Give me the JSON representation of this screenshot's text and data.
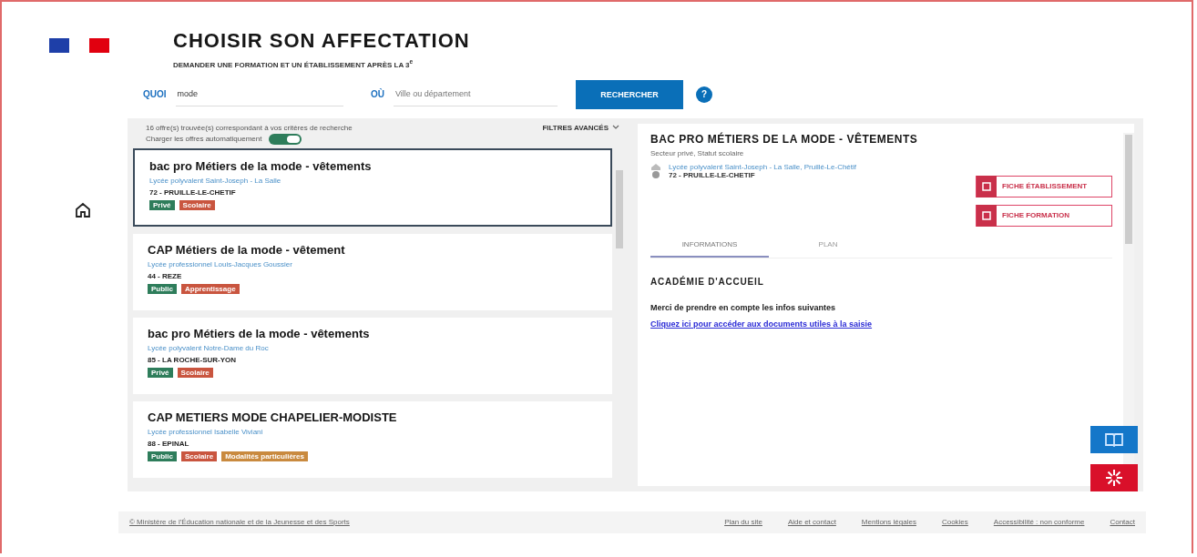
{
  "header": {
    "title": "CHOISIR SON AFFECTATION",
    "subtitle": "DEMANDER UNE FORMATION ET UN ÉTABLISSEMENT APRÈS LA 3$^{e}$"
  },
  "search": {
    "what_label": "QUOI",
    "what_value": "mode",
    "where_label": "OÙ",
    "where_placeholder": "Ville ou département",
    "button": "RECHERCHER",
    "help": "?"
  },
  "results": {
    "count_text": "16 offre(s) trouvée(s) correspondant à vos critères de recherche",
    "auto_load_label": "Charger les offres automatiquement",
    "auto_load_on": true,
    "filters": "FILTRES AVANCÉS"
  },
  "offers": [
    {
      "title": "bac pro Métiers de la mode - vêtements",
      "school": "Lycée polyvalent Saint-Joseph - La Salle",
      "place": "72 - PRUILLE-LE-CHETIF",
      "selected": true,
      "tags": [
        {
          "label": "Privé",
          "color": "#2e7d5b"
        },
        {
          "label": "Scolaire",
          "color": "#c9553f"
        }
      ]
    },
    {
      "title": "CAP Métiers de la mode - vêtement",
      "school": "Lycée professionnel Louis-Jacques Goussier",
      "place": "44 - REZE",
      "selected": false,
      "tags": [
        {
          "label": "Public",
          "color": "#2e7d5b"
        },
        {
          "label": "Apprentissage",
          "color": "#c9553f"
        }
      ]
    },
    {
      "title": "bac pro Métiers de la mode - vêtements",
      "school": "Lycée polyvalent Notre-Dame du Roc",
      "place": "85 - LA ROCHE-SUR-YON",
      "selected": false,
      "tags": [
        {
          "label": "Privé",
          "color": "#2e7d5b"
        },
        {
          "label": "Scolaire",
          "color": "#c9553f"
        }
      ]
    },
    {
      "title": "CAP METIERS MODE CHAPELIER-MODISTE",
      "school": "Lycée professionnel Isabelle Viviani",
      "place": "88 - EPINAL",
      "selected": false,
      "tags": [
        {
          "label": "Public",
          "color": "#2e7d5b"
        },
        {
          "label": "Scolaire",
          "color": "#c9553f"
        },
        {
          "label": "Modalités particulières",
          "color": "#c98a3f"
        }
      ]
    }
  ],
  "detail": {
    "title": "BAC PRO MÉTIERS DE LA MODE - VÊTEMENTS",
    "subtitle": "Secteur privé, Statut scolaire",
    "school": "Lycée polyvalent Saint-Joseph - La Salle, Pruillé-Le-Chétif",
    "place": "72 - PRUILLE-LE-CHETIF",
    "buttons": [
      "FICHE ÉTABLISSEMENT",
      "FICHE FORMATION"
    ],
    "tabs": [
      {
        "label": "INFORMATIONS",
        "selected": true
      },
      {
        "label": "PLAN",
        "selected": false
      }
    ],
    "section_title": "ACADÉMIE D'ACCUEIL",
    "note": "Merci de prendre en compte les infos suivantes",
    "link": "Cliquez ici pour accéder aux documents utiles à la saisie"
  },
  "footer": {
    "copyright": "© Ministère de l'Éducation nationale et de la Jeunesse et des Sports",
    "links": [
      "Plan du site",
      "Aide et contact",
      "Mentions légales",
      "Cookies",
      "Accessibilité : non conforme",
      "Contact"
    ]
  }
}
